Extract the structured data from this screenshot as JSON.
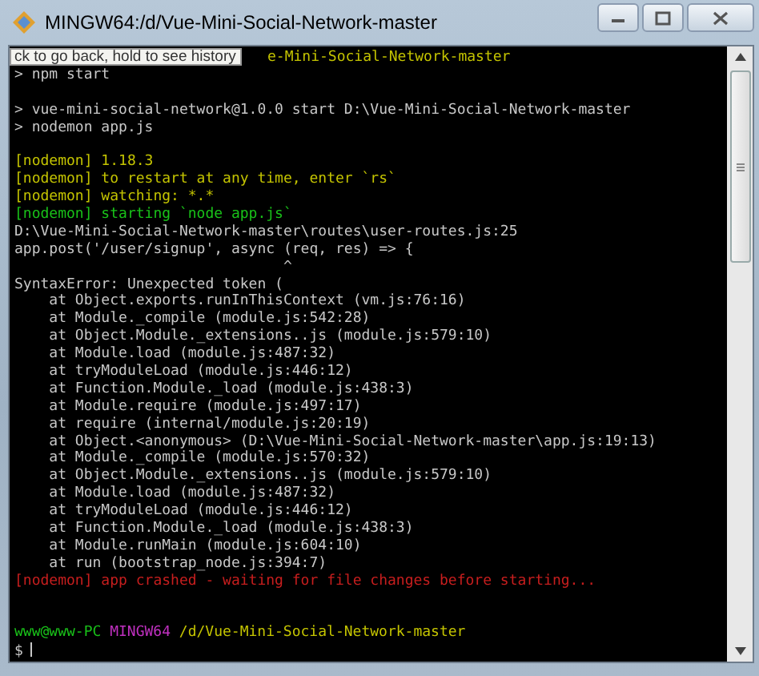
{
  "window": {
    "title": "MINGW64:/d/Vue-Mini-Social-Network-master"
  },
  "tooltip": "ck to go back, hold to see history",
  "terminal": {
    "lines": [
      {
        "kind": "partial",
        "text": "e-Mini-Social-Network-master"
      },
      {
        "kind": "output",
        "text": "> npm start"
      },
      {
        "kind": "blank"
      },
      {
        "kind": "output",
        "text": "> vue-mini-social-network@1.0.0 start D:\\Vue-Mini-Social-Network-master"
      },
      {
        "kind": "output",
        "text": "> nodemon app.js"
      },
      {
        "kind": "blank"
      },
      {
        "kind": "warning",
        "text": "[nodemon] 1.18.3"
      },
      {
        "kind": "warning",
        "text": "[nodemon] to restart at any time, enter `rs`"
      },
      {
        "kind": "warning",
        "text": "[nodemon] watching: *.*"
      },
      {
        "kind": "success",
        "text": "[nodemon] starting `node app.js`"
      },
      {
        "kind": "output",
        "text": "D:\\Vue-Mini-Social-Network-master\\routes\\user-routes.js:25"
      },
      {
        "kind": "output",
        "text": "app.post('/user/signup', async (req, res) => {"
      },
      {
        "kind": "output",
        "text": "                               ^"
      },
      {
        "kind": "output",
        "text": "SyntaxError: Unexpected token ("
      },
      {
        "kind": "output",
        "text": "    at Object.exports.runInThisContext (vm.js:76:16)"
      },
      {
        "kind": "output",
        "text": "    at Module._compile (module.js:542:28)"
      },
      {
        "kind": "output",
        "text": "    at Object.Module._extensions..js (module.js:579:10)"
      },
      {
        "kind": "output",
        "text": "    at Module.load (module.js:487:32)"
      },
      {
        "kind": "output",
        "text": "    at tryModuleLoad (module.js:446:12)"
      },
      {
        "kind": "output",
        "text": "    at Function.Module._load (module.js:438:3)"
      },
      {
        "kind": "output",
        "text": "    at Module.require (module.js:497:17)"
      },
      {
        "kind": "output",
        "text": "    at require (internal/module.js:20:19)"
      },
      {
        "kind": "output",
        "text": "    at Object.<anonymous> (D:\\Vue-Mini-Social-Network-master\\app.js:19:13)"
      },
      {
        "kind": "output",
        "text": "    at Module._compile (module.js:570:32)"
      },
      {
        "kind": "output",
        "text": "    at Object.Module._extensions..js (module.js:579:10)"
      },
      {
        "kind": "output",
        "text": "    at Module.load (module.js:487:32)"
      },
      {
        "kind": "output",
        "text": "    at tryModuleLoad (module.js:446:12)"
      },
      {
        "kind": "output",
        "text": "    at Function.Module._load (module.js:438:3)"
      },
      {
        "kind": "output",
        "text": "    at Module.runMain (module.js:604:10)"
      },
      {
        "kind": "output",
        "text": "    at run (bootstrap_node.js:394:7)"
      },
      {
        "kind": "error",
        "text": "[nodemon] app crashed - waiting for file changes before starting..."
      },
      {
        "kind": "blank"
      },
      {
        "kind": "blank"
      },
      {
        "kind": "prompt",
        "user": "www@www-PC",
        "system": "MINGW64",
        "path": "/d/Vue-Mini-Social-Network-master"
      },
      {
        "kind": "input",
        "text": "$"
      }
    ]
  }
}
